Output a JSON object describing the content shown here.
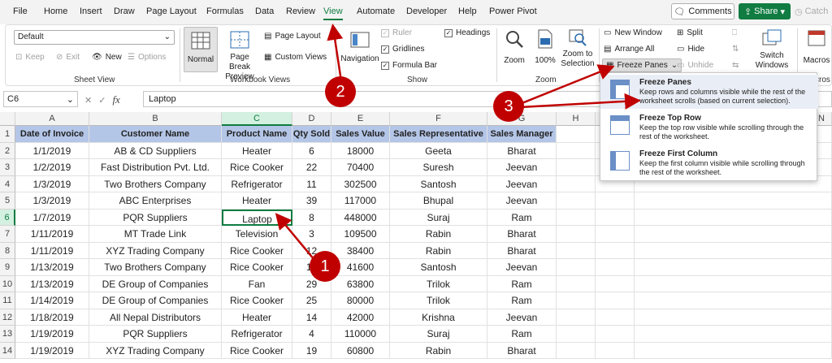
{
  "menu": {
    "items": [
      "File",
      "Home",
      "Insert",
      "Draw",
      "Page Layout",
      "Formulas",
      "Data",
      "Review",
      "View",
      "Automate",
      "Developer",
      "Help",
      "Power Pivot"
    ],
    "active": "View",
    "comments_label": "Comments",
    "share_label": "Share",
    "catch_label": "Catch"
  },
  "ribbon": {
    "sheet_view": {
      "select_value": "Default",
      "keep": "Keep",
      "exit": "Exit",
      "new": "New",
      "options": "Options",
      "label": "Sheet View"
    },
    "workbook_views": {
      "normal": "Normal",
      "page_break_l1": "Page Break",
      "page_break_l2": "Preview",
      "page_layout": "Page Layout",
      "custom_views": "Custom Views",
      "label": "Workbook Views"
    },
    "show": {
      "navigation": "Navigation",
      "ruler": "Ruler",
      "gridlines": "Gridlines",
      "formula_bar": "Formula Bar",
      "headings": "Headings",
      "label": "Show"
    },
    "zoom": {
      "zoom": "Zoom",
      "hundred": "100%",
      "zoom_sel_l1": "Zoom to",
      "zoom_sel_l2": "Selection",
      "label": "Zoom"
    },
    "window": {
      "new_window": "New Window",
      "arrange_all": "Arrange All",
      "freeze_panes": "Freeze Panes",
      "split": "Split",
      "hide": "Hide",
      "unhide": "Unhide",
      "switch_l1": "Switch",
      "switch_l2": "Windows",
      "macros": "Macros",
      "macros_label": "cros"
    }
  },
  "formula_bar": {
    "name_box": "C6",
    "fx": "fx",
    "content": "Laptop"
  },
  "columns": [
    "A",
    "B",
    "C",
    "D",
    "E",
    "F",
    "G",
    "H",
    "I",
    "N"
  ],
  "row_numbers": [
    "1",
    "2",
    "3",
    "4",
    "5",
    "6",
    "7",
    "8",
    "9",
    "10",
    "11",
    "12",
    "13",
    "14"
  ],
  "table": {
    "headers": [
      "Date of Invoice",
      "Customer Name",
      "Product Name",
      "Qty Sold",
      "Sales Value",
      "Sales Representative",
      "Sales Manager"
    ],
    "rows": [
      [
        "1/1/2019",
        "AB & CD Suppliers",
        "Heater",
        "6",
        "18000",
        "Geeta",
        "Bharat"
      ],
      [
        "1/2/2019",
        "Fast Distribution Pvt. Ltd.",
        "Rice Cooker",
        "22",
        "70400",
        "Suresh",
        "Jeevan"
      ],
      [
        "1/3/2019",
        "Two Brothers Company",
        "Refrigerator",
        "11",
        "302500",
        "Santosh",
        "Jeevan"
      ],
      [
        "1/3/2019",
        "ABC Enterprises",
        "Heater",
        "39",
        "117000",
        "Bhupal",
        "Jeevan"
      ],
      [
        "1/7/2019",
        "PQR Suppliers",
        "Laptop",
        "8",
        "448000",
        "Suraj",
        "Ram"
      ],
      [
        "1/11/2019",
        "MT Trade Link",
        "Television",
        "3",
        "109500",
        "Rabin",
        "Bharat"
      ],
      [
        "1/11/2019",
        "XYZ Trading Company",
        "Rice Cooker",
        "12",
        "38400",
        "Rabin",
        "Bharat"
      ],
      [
        "1/13/2019",
        "Two Brothers Company",
        "Rice Cooker",
        "13",
        "41600",
        "Santosh",
        "Jeevan"
      ],
      [
        "1/13/2019",
        "DE Group of Companies",
        "Fan",
        "29",
        "63800",
        "Trilok",
        "Ram"
      ],
      [
        "1/14/2019",
        "DE Group of Companies",
        "Rice Cooker",
        "25",
        "80000",
        "Trilok",
        "Ram"
      ],
      [
        "1/18/2019",
        "All Nepal Distributors",
        "Heater",
        "14",
        "42000",
        "Krishna",
        "Jeevan"
      ],
      [
        "1/19/2019",
        "PQR Suppliers",
        "Refrigerator",
        "4",
        "110000",
        "Suraj",
        "Ram"
      ],
      [
        "1/19/2019",
        "XYZ Trading Company",
        "Rice Cooker",
        "19",
        "60800",
        "Rabin",
        "Bharat"
      ]
    ]
  },
  "dropdown": {
    "items": [
      {
        "title": "Freeze Panes",
        "desc": "Keep rows and columns visible while the rest of the worksheet scrolls (based on current selection)."
      },
      {
        "title": "Freeze Top Row",
        "desc": "Keep the top row visible while scrolling through the rest of the worksheet."
      },
      {
        "title": "Freeze First Column",
        "desc": "Keep the first column visible while scrolling through the rest of the worksheet."
      }
    ]
  },
  "annotations": [
    "1",
    "2",
    "3"
  ],
  "colors": {
    "excel_green": "#107c41",
    "header_fill": "#b4c6e7",
    "annotation_red": "#c00000"
  }
}
